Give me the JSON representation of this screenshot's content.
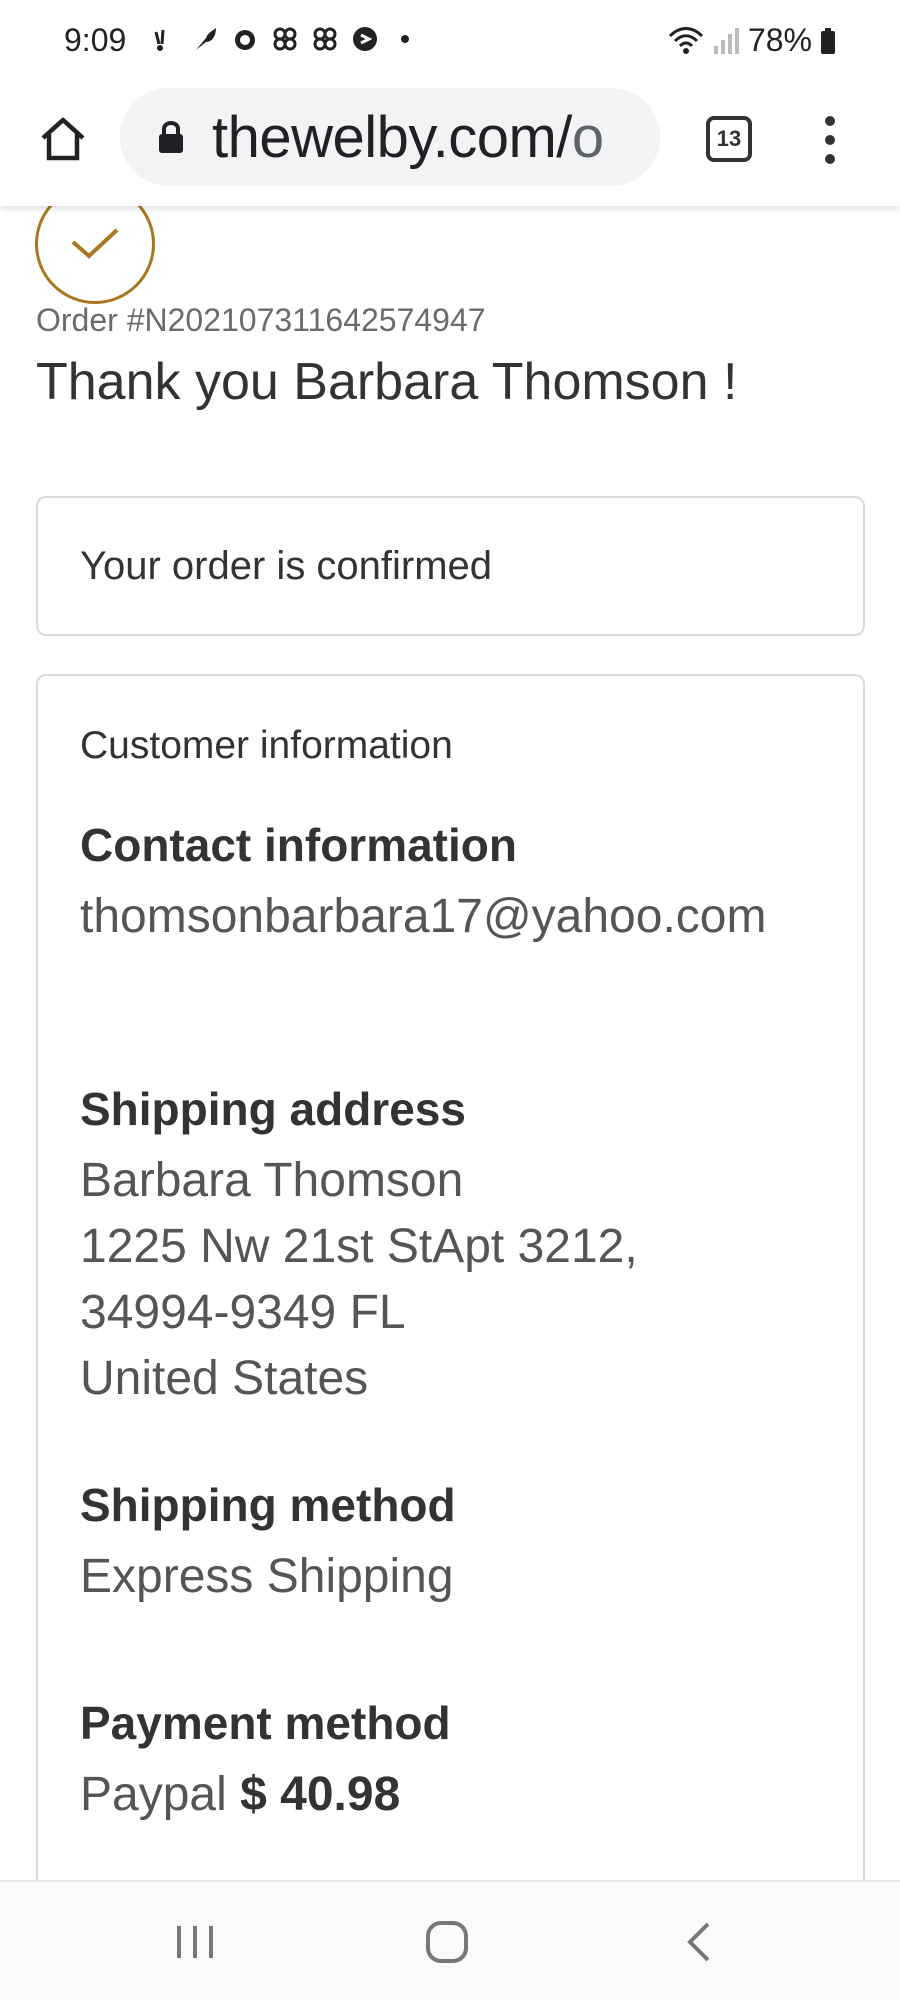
{
  "status_bar": {
    "time": "9:09",
    "battery": "78%",
    "icons": [
      "notification-icon",
      "leaf-icon",
      "alarm-icon",
      "app-icon",
      "app-icon",
      "shazam-icon",
      "dot-icon"
    ]
  },
  "browser": {
    "url_main": "thewelby.com/",
    "url_tail": "o",
    "tab_count": "13"
  },
  "page": {
    "order_number": "Order #N2021073116425​74947",
    "thank_you": "Thank you Barbara Thomson !",
    "confirmed": "Your order is confirmed",
    "customer_info_title": "Customer information",
    "contact": {
      "heading": "Contact information",
      "email": "thomsonbarbara17@yahoo.com"
    },
    "shipping_address": {
      "heading": "Shipping address",
      "name": "Barbara Thomson",
      "line1": "1225 Nw 21st StApt 3212,",
      "line2": "34994-9349 FL",
      "country": "United States"
    },
    "shipping_method": {
      "heading": "Shipping method",
      "value": "Express Shipping"
    },
    "payment_method": {
      "heading": "Payment method",
      "provider": "Paypal",
      "amount": "$ 40.98"
    }
  },
  "colors": {
    "accent": "#a8771f",
    "border": "#dadada",
    "text": "#333333",
    "muted": "#555555"
  }
}
